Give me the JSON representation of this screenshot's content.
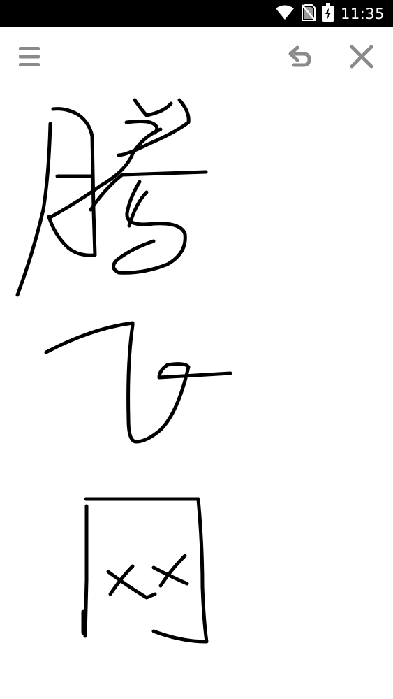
{
  "status_bar": {
    "time": "11:35",
    "icons": [
      "wifi-icon",
      "no-sim-icon",
      "battery-charging-icon"
    ],
    "background": "#000000"
  },
  "toolbar": {
    "menu_icon": "hamburger-menu-icon",
    "undo_icon": "undo-icon",
    "close_icon": "close-icon",
    "icon_color": "#8a8a8a"
  },
  "canvas": {
    "background": "#ffffff",
    "ink_color": "#000000"
  }
}
